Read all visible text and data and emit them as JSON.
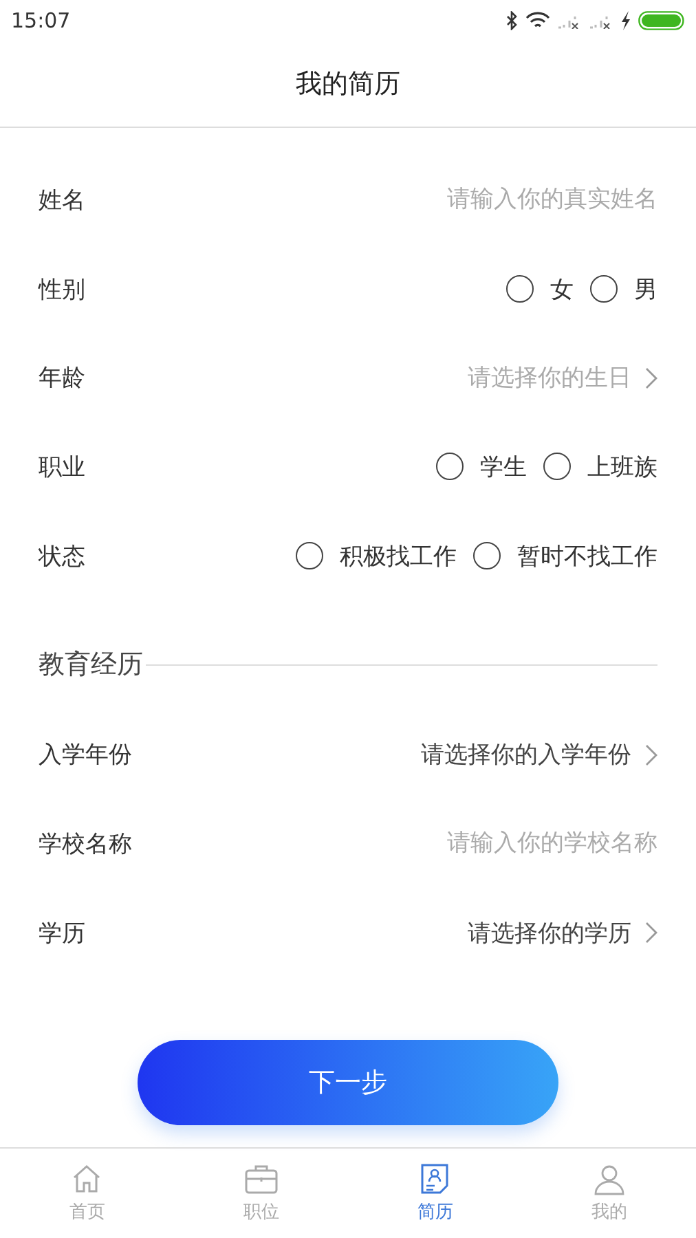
{
  "status_bar": {
    "time": "15:07"
  },
  "header": {
    "title": "我的简历"
  },
  "sections": [
    {
      "rows": [
        {
          "kind": "input",
          "label": "姓名",
          "placeholder": "请输入你的真实姓名"
        },
        {
          "kind": "radio",
          "label": "性别",
          "options": [
            {
              "label": "女",
              "selected": false
            },
            {
              "label": "男",
              "selected": false
            }
          ]
        },
        {
          "kind": "picker",
          "label": "年龄",
          "text": "请选择你的生日",
          "muted": true
        },
        {
          "kind": "radio",
          "label": "职业",
          "options": [
            {
              "label": "学生",
              "selected": false
            },
            {
              "label": "上班族",
              "selected": false
            }
          ]
        },
        {
          "kind": "radio",
          "label": "状态",
          "options": [
            {
              "label": "积极找工作",
              "selected": false
            },
            {
              "label": "暂时不找工作",
              "selected": false
            }
          ]
        }
      ]
    },
    {
      "title": "教育经历",
      "rows": [
        {
          "kind": "picker",
          "label": "入学年份",
          "text": "请选择你的入学年份",
          "muted": false
        },
        {
          "kind": "input",
          "label": "学校名称",
          "placeholder": "请输入你的学校名称"
        },
        {
          "kind": "picker",
          "label": "学历",
          "text": "请选择你的学历",
          "muted": false
        }
      ]
    }
  ],
  "next_button": "下一步",
  "tabs": [
    {
      "kind": "home",
      "label": "首页",
      "selected": false
    },
    {
      "kind": "briefcase",
      "label": "职位",
      "selected": false
    },
    {
      "kind": "resume",
      "label": "简历",
      "selected": true
    },
    {
      "kind": "person",
      "label": "我的",
      "selected": false
    }
  ]
}
